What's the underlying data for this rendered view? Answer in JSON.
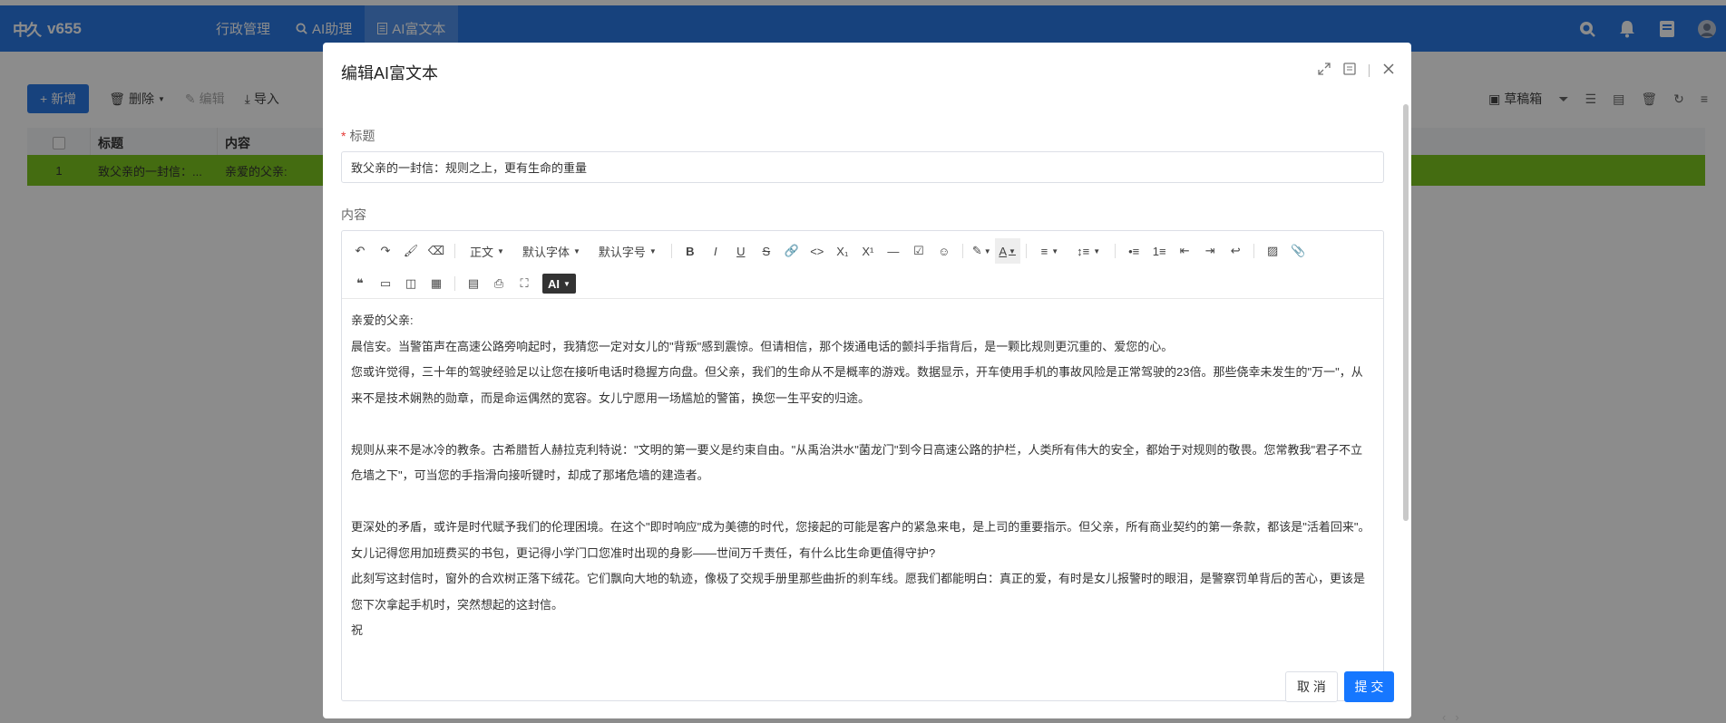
{
  "app": {
    "logo_text": "v655"
  },
  "nav": {
    "tabs": [
      {
        "label": "行政管理",
        "icon": "none"
      },
      {
        "label": "AI助理",
        "icon": "search-icon"
      },
      {
        "label": "AI富文本",
        "icon": "document-icon"
      }
    ],
    "active_tab": 2
  },
  "toolbar": {
    "new_label": "新增",
    "delete_label": "删除",
    "edit_label": "编辑",
    "import_label": "导入",
    "drafts_label": "草稿箱"
  },
  "table": {
    "headers": [
      "标题",
      "内容"
    ],
    "rows": [
      {
        "index": "1",
        "title": "致父亲的一封信：...",
        "content": "亲爱的父亲:"
      }
    ]
  },
  "modal": {
    "title": "编辑AI富文本",
    "title_field_label": "标题",
    "title_field_value": "致父亲的一封信：规则之上，更有生命的重量",
    "content_field_label": "内容",
    "cancel_label": "取 消",
    "submit_label": "提 交"
  },
  "editor": {
    "paragraph_style": "正文",
    "font_family": "默认字体",
    "font_size": "默认字号",
    "ai_label": "AI",
    "content": [
      "亲爱的父亲:",
      "晨信安。当警笛声在高速公路旁响起时，我猜您一定对女儿的\"背叛\"感到震惊。但请相信，那个拨通电话的颤抖手指背后，是一颗比规则更沉重的、爱您的心。",
      "您或许觉得，三十年的驾驶经验足以让您在接听电话时稳握方向盘。但父亲，我们的生命从不是概率的游戏。数据显示，开车使用手机的事故风险是正常驾驶的23倍。那些侥幸未发生的\"万一\"，从来不是技术娴熟的勋章，而是命运偶然的宽容。女儿宁愿用一场尴尬的警笛，换您一生平安的归途。",
      "",
      "规则从来不是冰冷的教条。古希腊哲人赫拉克利特说：\"文明的第一要义是约束自由。\"从禹治洪水\"菌龙门\"到今日高速公路的护栏，人类所有伟大的安全，都始于对规则的敬畏。您常教我\"君子不立危墙之下\"，可当您的手指滑向接听键时，却成了那堵危墙的建造者。",
      "",
      "更深处的矛盾，或许是时代赋予我们的伦理困境。在这个\"即时响应\"成为美德的时代，您接起的可能是客户的紧急来电，是上司的重要指示。但父亲，所有商业契约的第一条款，都该是\"活着回来\"。女儿记得您用加班费买的书包，更记得小学门口您准时出现的身影——世间万千责任，有什么比生命更值得守护?",
      "此刻写这封信时，窗外的合欢树正落下绒花。它们飘向大地的轨迹，像极了交规手册里那些曲折的刹车线。愿我们都能明白：真正的爱，有时是女儿报警时的眼泪，是警察罚单背后的苦心，更该是您下次拿起手机时，突然想起的这封信。",
      "祝"
    ]
  },
  "colors": {
    "nav_bg": "#2b78e4",
    "row_highlight": "#7cc51f",
    "primary": "#1677ff"
  }
}
